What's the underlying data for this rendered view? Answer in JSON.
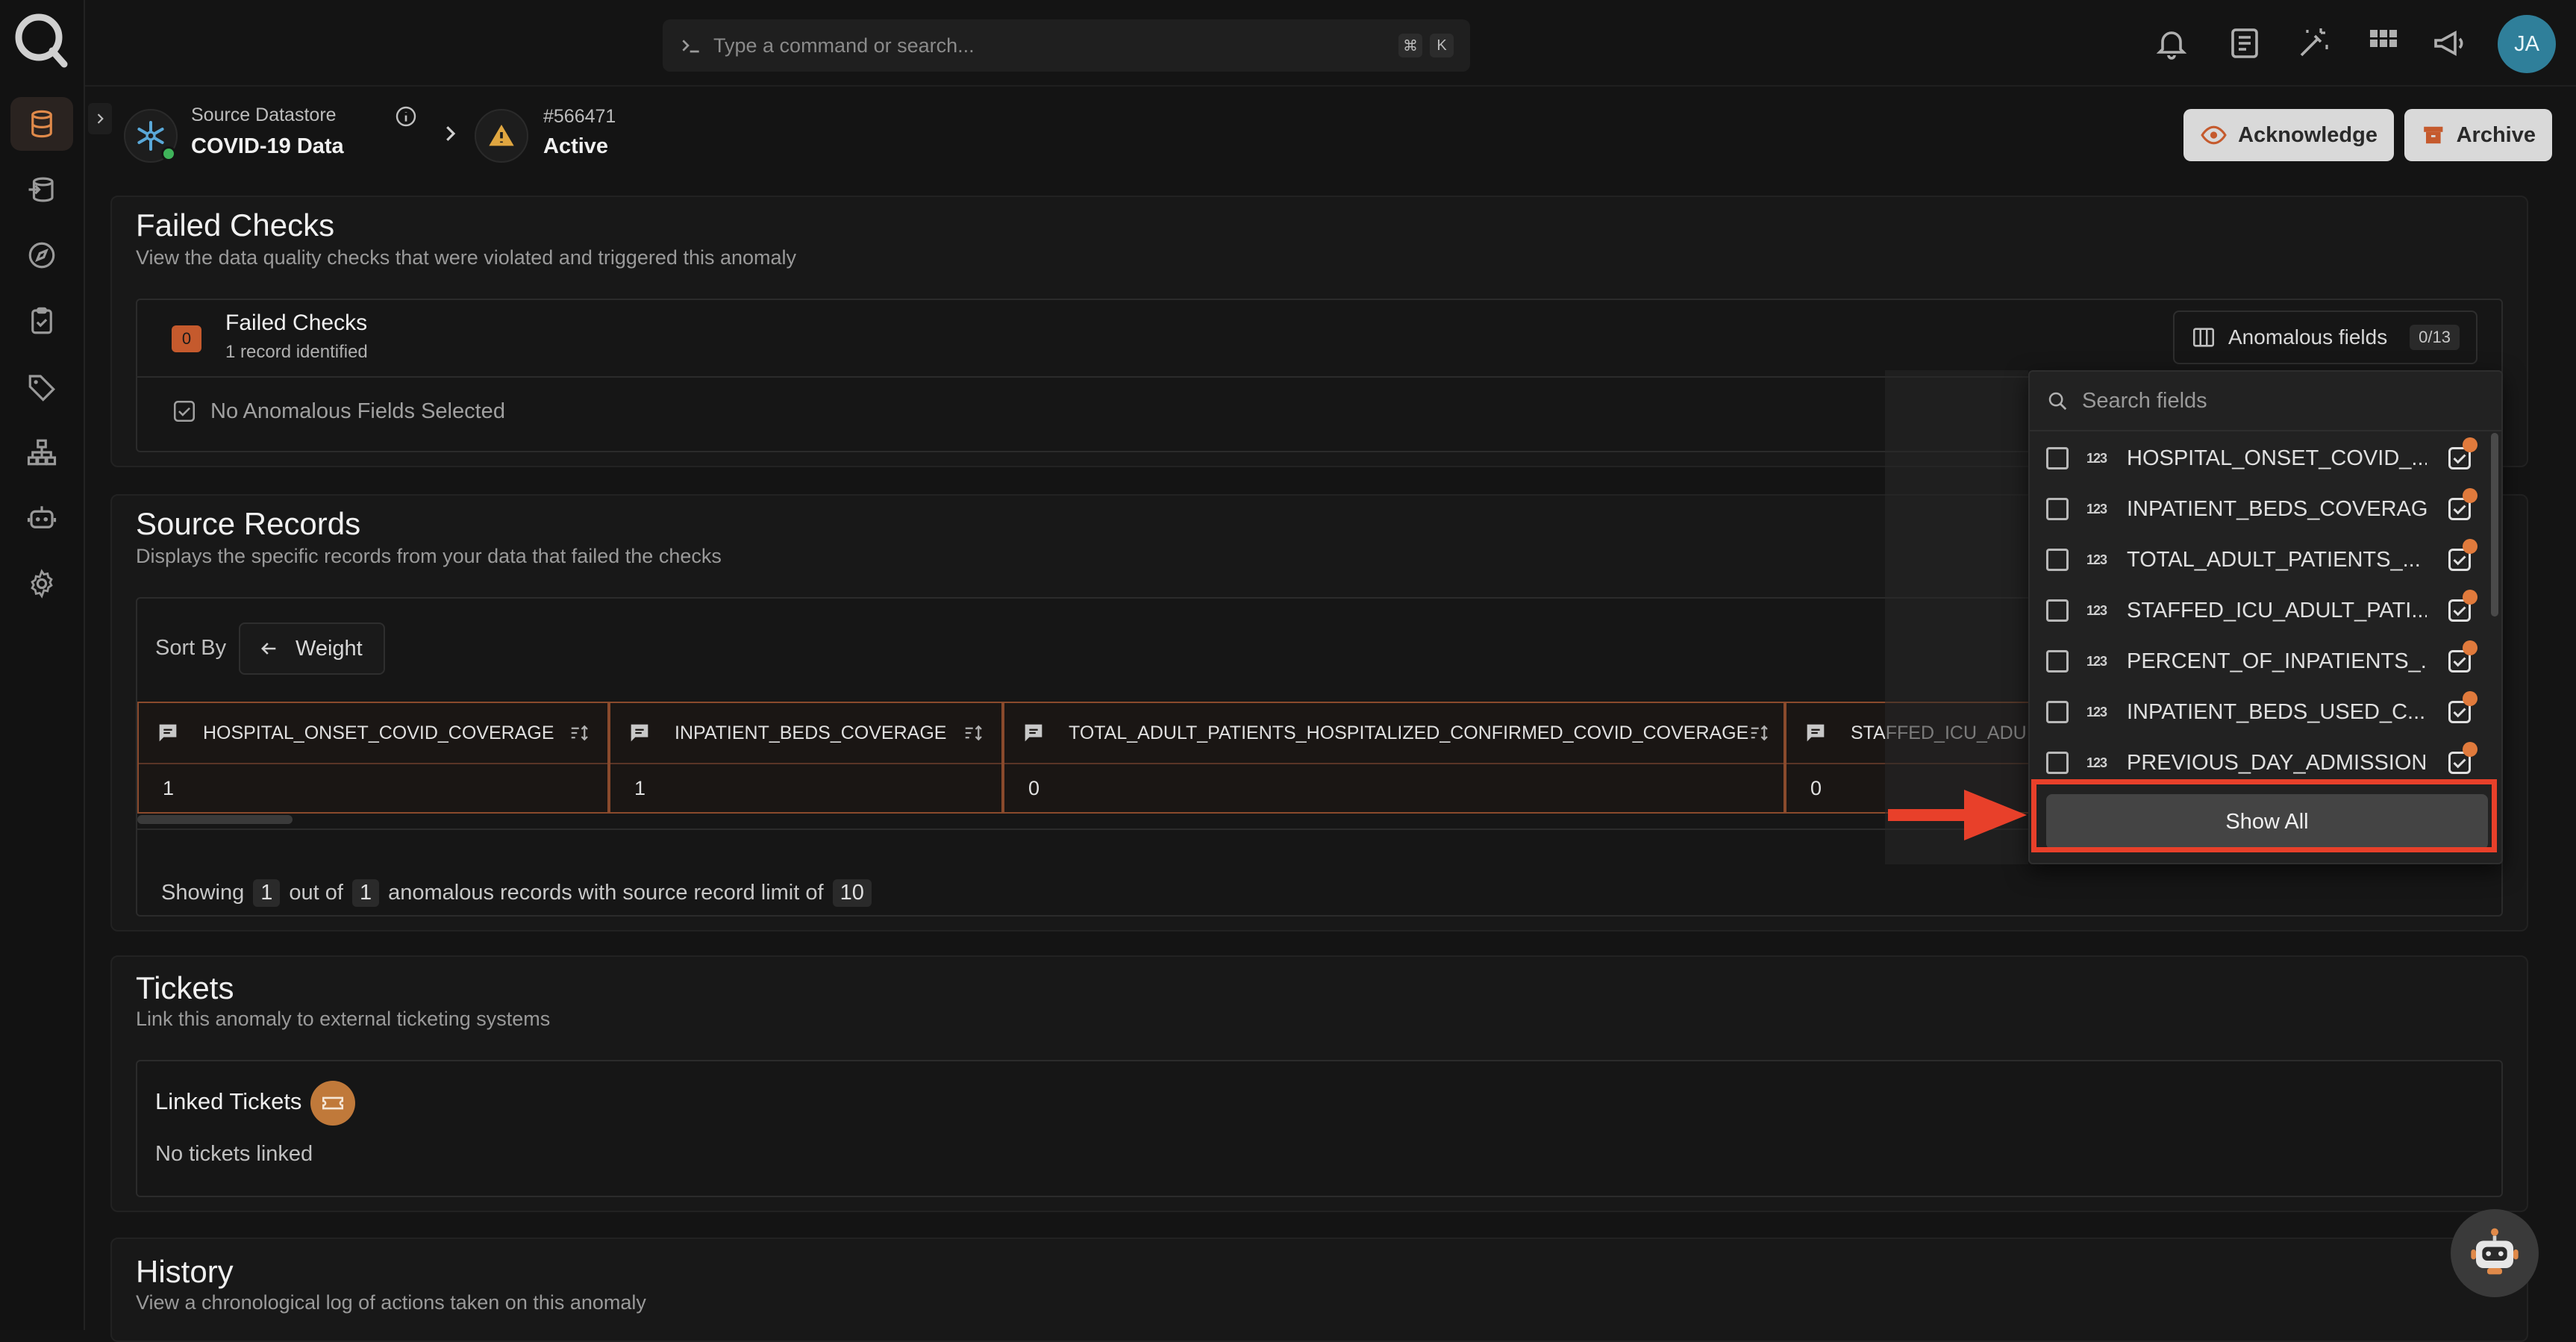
{
  "command_bar": {
    "placeholder": "Type a command or search...",
    "key1": "⌘",
    "key2": "K"
  },
  "user": {
    "initials": "JA"
  },
  "header": {
    "datastore_label": "Source Datastore",
    "datastore_name": "COVID-19 Data",
    "anomaly_id": "#566471",
    "anomaly_status": "Active",
    "acknowledge_label": "Acknowledge",
    "archive_label": "Archive"
  },
  "failed_checks": {
    "title": "Failed Checks",
    "description": "View the data quality checks that were violated and triggered this anomaly",
    "badge": "0",
    "box_title": "Failed Checks",
    "box_sub": "1 record identified",
    "anomalous_fields_label": "Anomalous fields",
    "anomalous_fields_count": "0/13",
    "no_fields": "No Anomalous Fields Selected"
  },
  "source_records": {
    "title": "Source Records",
    "description": "Displays the specific records from your data that failed the checks",
    "sort_by": "Sort By",
    "sort_value": "Weight",
    "columns": [
      {
        "name": "HOSPITAL_ONSET_COVID_COVERAGE",
        "value": "1"
      },
      {
        "name": "INPATIENT_BEDS_COVERAGE",
        "value": "1"
      },
      {
        "name": "TOTAL_ADULT_PATIENTS_HOSPITALIZED_CONFIRMED_COVID_COVERAGE",
        "value": "0"
      },
      {
        "name": "STAFFED_ICU_ADU",
        "value": "0"
      }
    ],
    "showing": {
      "prefix": "Showing",
      "count": "1",
      "mid": "out of",
      "total": "1",
      "suffix": "anomalous records with source record limit of",
      "limit": "10"
    }
  },
  "tickets": {
    "title": "Tickets",
    "description": "Link this anomaly to external ticketing systems",
    "linked_label": "Linked Tickets",
    "empty": "No tickets linked"
  },
  "history": {
    "title": "History",
    "description": "View a chronological log of actions taken on this anomaly"
  },
  "fields_dropdown": {
    "search_placeholder": "Search fields",
    "type_label": "123",
    "items": [
      "HOSPITAL_ONSET_COVID_...",
      "INPATIENT_BEDS_COVERAGE",
      "TOTAL_ADULT_PATIENTS_...",
      "STAFFED_ICU_ADULT_PATI...",
      "PERCENT_OF_INPATIENTS_...",
      "INPATIENT_BEDS_USED_C...",
      "PREVIOUS_DAY_ADMISSION..."
    ],
    "show_all": "Show All"
  },
  "colors": {
    "accent": "#c55a2d",
    "highlight": "#e8402a",
    "status_ok": "#3fb35a"
  }
}
